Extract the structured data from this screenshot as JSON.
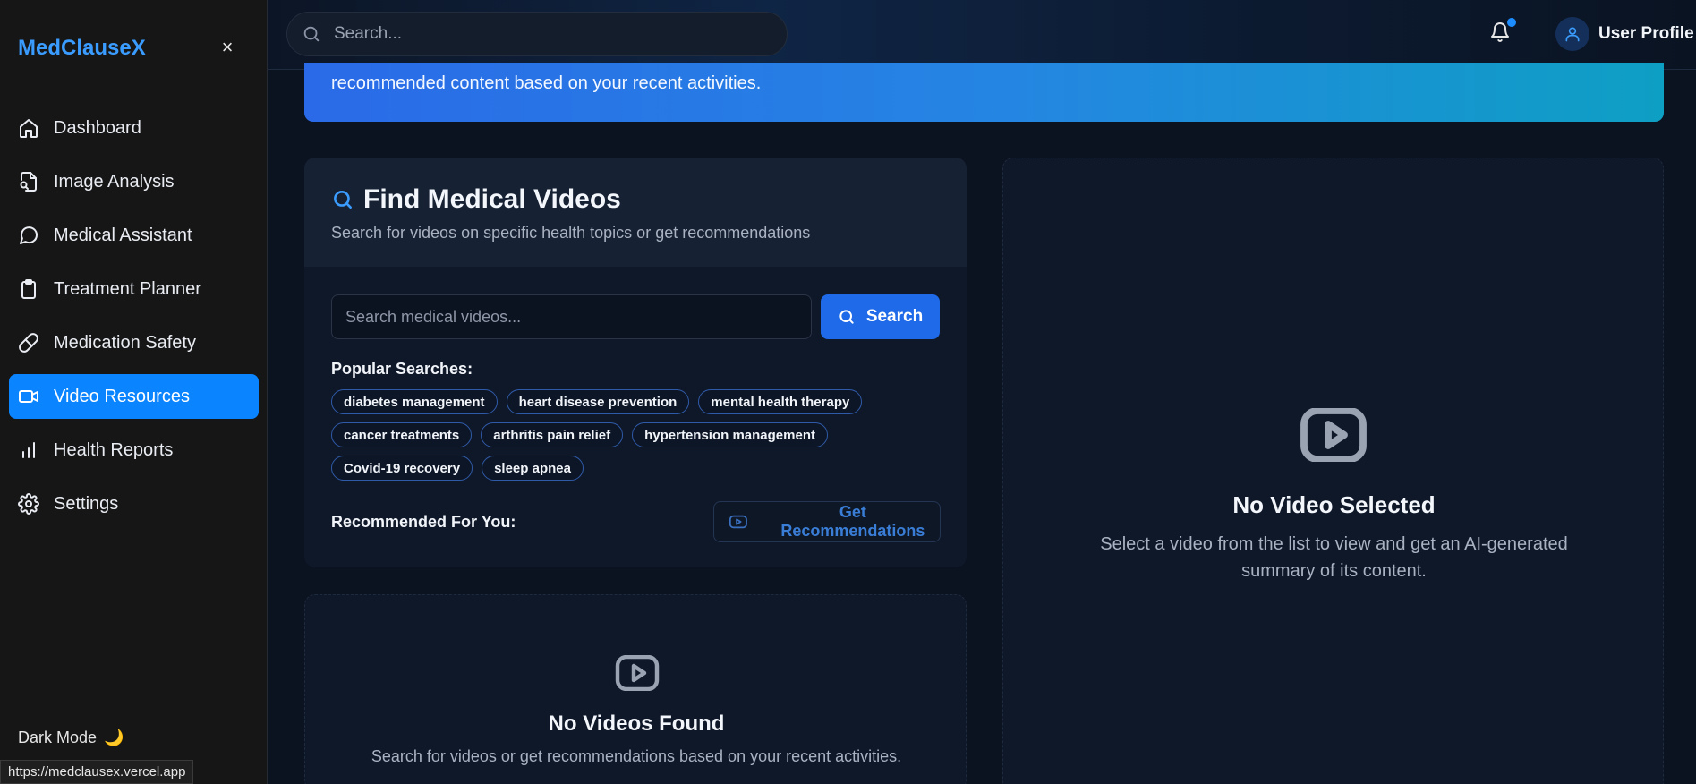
{
  "app": {
    "brand": "MedClauseX",
    "close_label": "×"
  },
  "sidebar": {
    "items": [
      {
        "label": "Dashboard",
        "icon": "home-icon",
        "active": false
      },
      {
        "label": "Image Analysis",
        "icon": "file-search-icon",
        "active": false
      },
      {
        "label": "Medical Assistant",
        "icon": "chat-bubble-icon",
        "active": false
      },
      {
        "label": "Treatment Planner",
        "icon": "clipboard-icon",
        "active": false
      },
      {
        "label": "Medication Safety",
        "icon": "pill-icon",
        "active": false
      },
      {
        "label": "Video Resources",
        "icon": "video-camera-icon",
        "active": true
      },
      {
        "label": "Health Reports",
        "icon": "bar-chart-icon",
        "active": false
      },
      {
        "label": "Settings",
        "icon": "gear-icon",
        "active": false
      }
    ],
    "dark_mode_label": "Dark Mode",
    "dark_mode_emoji": "🌙"
  },
  "status_bar": {
    "url": "https://medclausex.vercel.app"
  },
  "header": {
    "search_placeholder": "Search...",
    "profile_name": "User Profile"
  },
  "banner": {
    "text": "recommended content based on your recent activities."
  },
  "find": {
    "title": "Find Medical Videos",
    "subtitle": "Search for videos on specific health topics or get recommendations",
    "search_placeholder": "Search medical videos...",
    "search_button": "Search",
    "popular_label": "Popular Searches:",
    "popular": [
      "diabetes management",
      "heart disease prevention",
      "mental health therapy",
      "cancer treatments",
      "arthritis pain relief",
      "hypertension management",
      "Covid-19 recovery",
      "sleep apnea"
    ],
    "recommended_label": "Recommended For You:",
    "recommend_button": "Get Recommendations"
  },
  "results": {
    "empty_title": "No Videos Found",
    "empty_subtitle": "Search for videos or get recommendations based on your recent activities."
  },
  "viewer": {
    "empty_title": "No Video Selected",
    "empty_subtitle": "Select a video from the list to view and get an AI-generated summary of its content."
  },
  "colors": {
    "accent": "#0a84ff",
    "brand": "#3b9cff",
    "button": "#1f6ae8"
  }
}
